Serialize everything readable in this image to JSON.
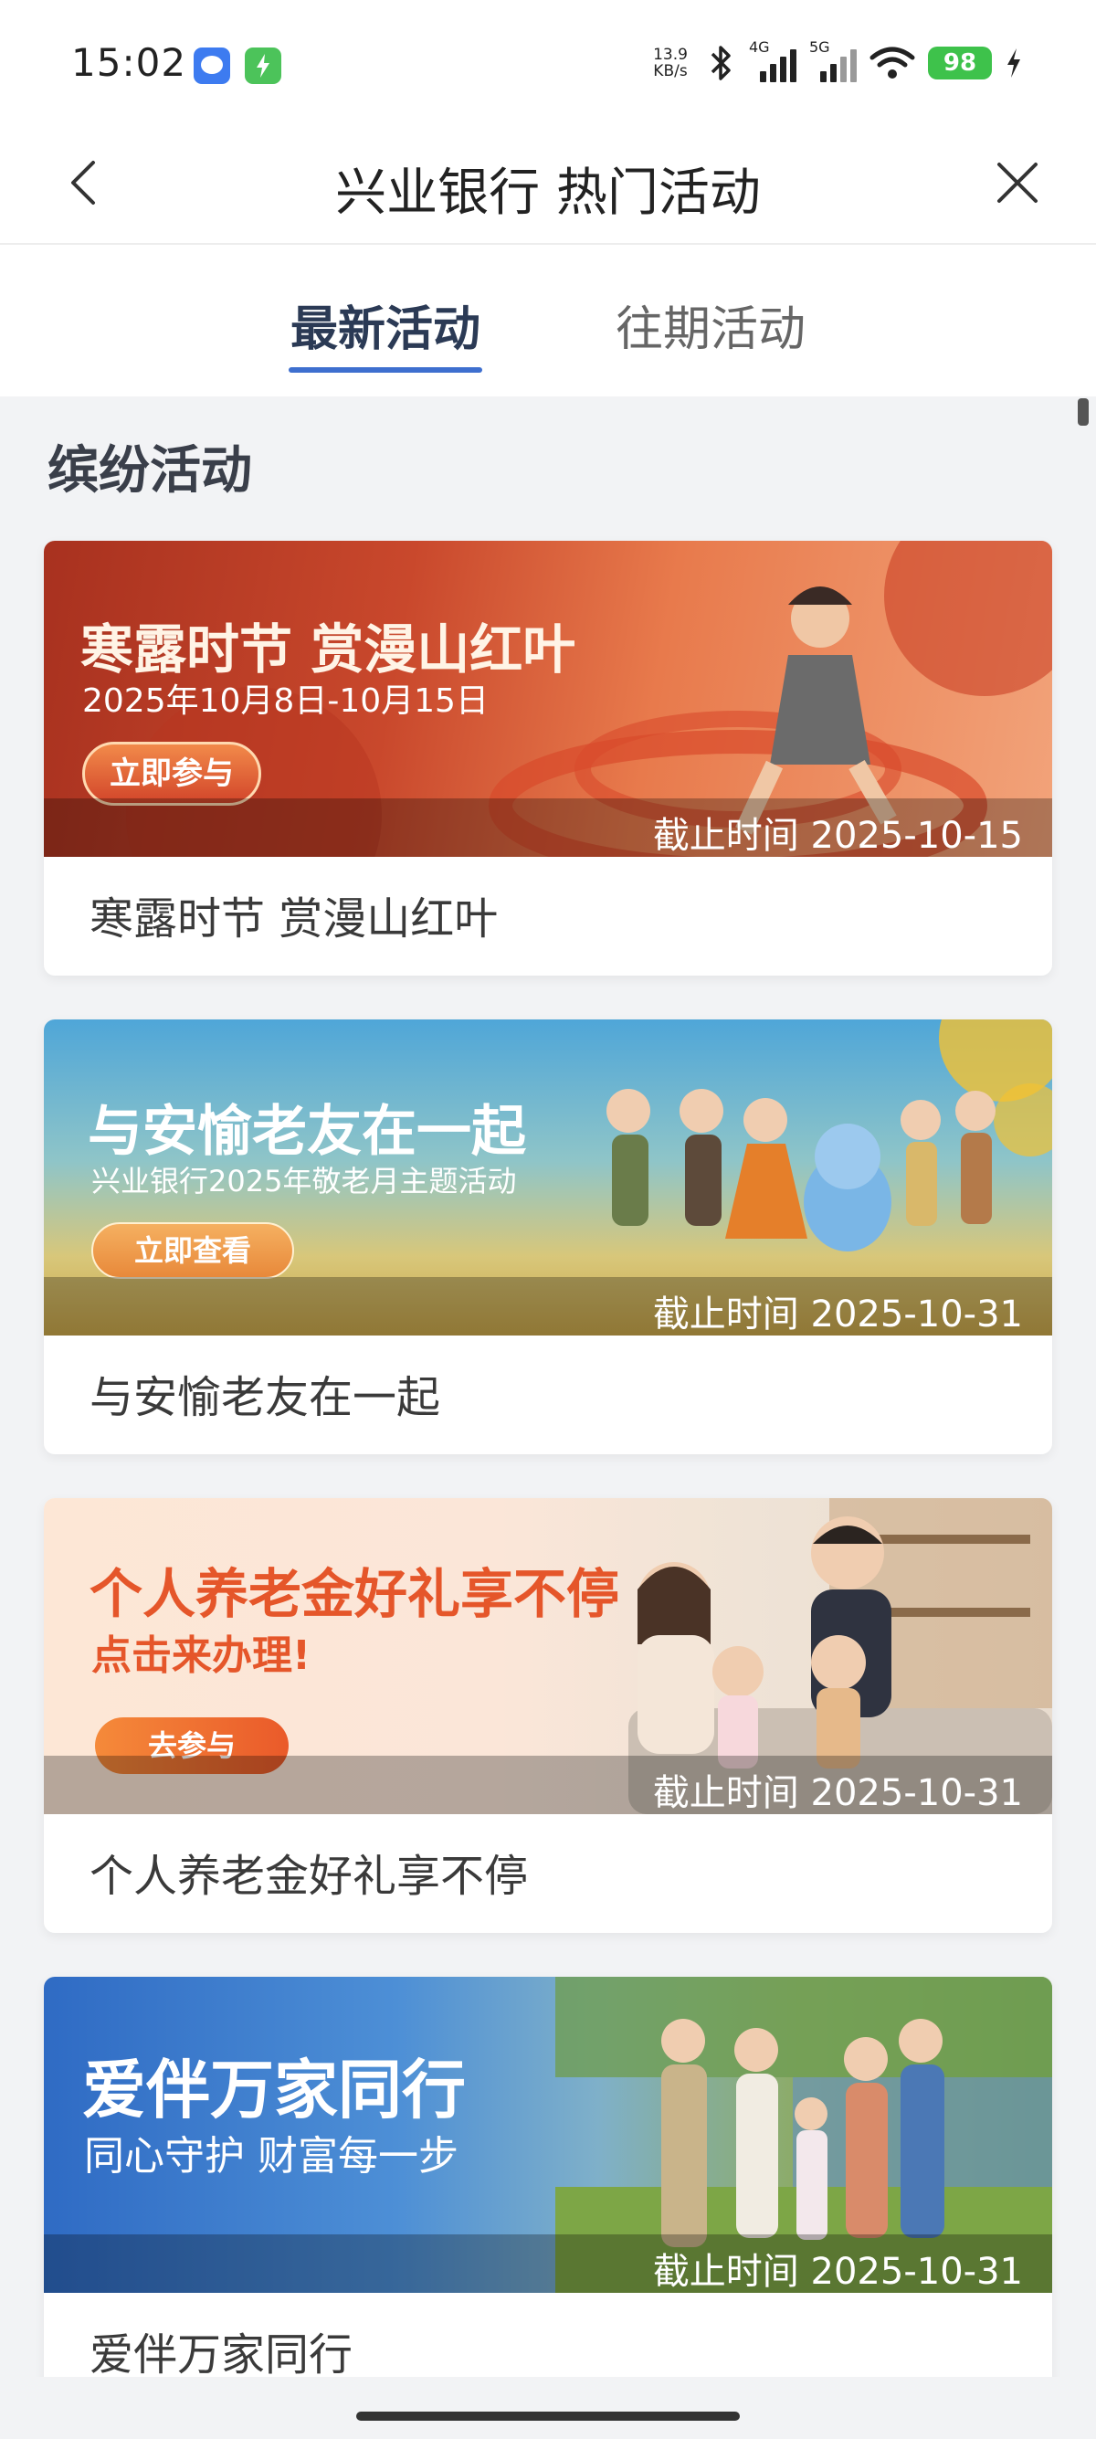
{
  "status_bar": {
    "time": "15:02",
    "net_speed_value": "13.9",
    "net_speed_unit": "KB/s",
    "sim1_tag": "4G",
    "sim2_tag": "5G",
    "battery_level": "98",
    "icons": [
      "message-app-icon",
      "charging-app-icon",
      "bluetooth-icon",
      "signal-icon",
      "wifi-icon",
      "battery-icon",
      "charge-icon"
    ]
  },
  "nav": {
    "title": "兴业银行 热门活动",
    "back_icon": "chevron-left-icon",
    "close_icon": "close-icon"
  },
  "tabs": [
    {
      "label": "最新活动",
      "active": true
    },
    {
      "label": "往期活动",
      "active": false
    }
  ],
  "section": {
    "title": "缤纷活动"
  },
  "cards": [
    {
      "banner_headline": "寒露时节 赏漫山红叶",
      "banner_subline": "2025年10月8日-10月15日",
      "banner_button": "立即参与",
      "deadline": "截止时间 2025-10-15",
      "caption": "寒露时节 赏漫山红叶"
    },
    {
      "banner_headline": "与安愉老友在一起",
      "banner_subline": "兴业银行2025年敬老月主题活动",
      "banner_button": "立即查看",
      "deadline": "截止时间 2025-10-31",
      "caption": "与安愉老友在一起"
    },
    {
      "banner_headline": "个人养老金好礼享不停",
      "banner_subline": "点击来办理!",
      "banner_button": "去参与",
      "deadline": "截止时间 2025-10-31",
      "caption": "个人养老金好礼享不停"
    },
    {
      "banner_headline": "爱伴万家同行",
      "banner_subline": "同心守护 财富每一步",
      "deadline": "截止时间 2025-10-31",
      "caption": "爱伴万家同行"
    }
  ],
  "colors": {
    "tab_active_underline": "#3e6fcf",
    "battery_green": "#3ec24b",
    "page_background": "#f2f3f5"
  }
}
